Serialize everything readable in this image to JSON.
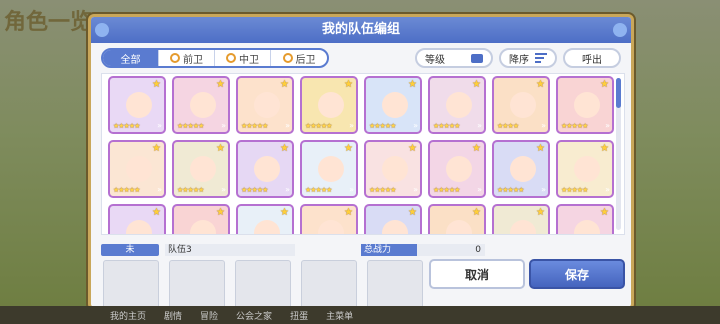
{
  "background": {
    "title": "角色一览"
  },
  "modal": {
    "title": "我的队伍编组",
    "tabs": [
      {
        "label": "全部",
        "active": true
      },
      {
        "label": "前卫",
        "active": false
      },
      {
        "label": "中卫",
        "active": false
      },
      {
        "label": "后卫",
        "active": false
      }
    ],
    "level_label": "等级",
    "sort_label": "降序",
    "call_label": "呼出",
    "team_tag": "未",
    "team_name": "队伍3",
    "power_label": "总战力",
    "power_value": "0",
    "cancel_label": "取消",
    "save_label": "保存"
  },
  "bottom_nav": [
    "我的主页",
    "剧情",
    "冒险",
    "公会之家",
    "扭蛋",
    "主菜单"
  ],
  "colors": {
    "accent": "#4d6ec6",
    "card_border": "#b570d1",
    "card_palette": [
      "#e9d9f5",
      "#f5d5e2",
      "#fde2cc",
      "#f8e6b0",
      "#d8e4f8",
      "#f0dcea",
      "#fbe0c6",
      "#f9d4d4",
      "#fbe6d4",
      "#f0ead4",
      "#e6d8f4",
      "#e8f0f8",
      "#f9e2e2",
      "#f3d6e6",
      "#d9dcf5",
      "#f8ecd0"
    ]
  },
  "cards": [
    {
      "stars": "★★★★★",
      "color_index": 0
    },
    {
      "stars": "★★★★★",
      "color_index": 1
    },
    {
      "stars": "★★★★★",
      "color_index": 2
    },
    {
      "stars": "★★★★★",
      "color_index": 3
    },
    {
      "stars": "★★★★★",
      "color_index": 4
    },
    {
      "stars": "★★★★★",
      "color_index": 5
    },
    {
      "stars": "★★★★",
      "color_index": 6
    },
    {
      "stars": "★★★★★",
      "color_index": 7
    },
    {
      "stars": "★★★★★",
      "color_index": 8
    },
    {
      "stars": "★★★★★",
      "color_index": 9
    },
    {
      "stars": "★★★★★",
      "color_index": 10
    },
    {
      "stars": "★★★★★",
      "color_index": 11
    },
    {
      "stars": "★★★★★",
      "color_index": 12
    },
    {
      "stars": "★★★★★",
      "color_index": 13
    },
    {
      "stars": "★★★★★",
      "color_index": 14
    },
    {
      "stars": "★★★★★",
      "color_index": 15
    },
    {
      "stars": "",
      "color_index": 0
    },
    {
      "stars": "",
      "color_index": 7
    },
    {
      "stars": "",
      "color_index": 11
    },
    {
      "stars": "",
      "color_index": 2
    },
    {
      "stars": "",
      "color_index": 14
    },
    {
      "stars": "",
      "color_index": 6
    },
    {
      "stars": "",
      "color_index": 9
    },
    {
      "stars": "",
      "color_index": 1
    }
  ]
}
